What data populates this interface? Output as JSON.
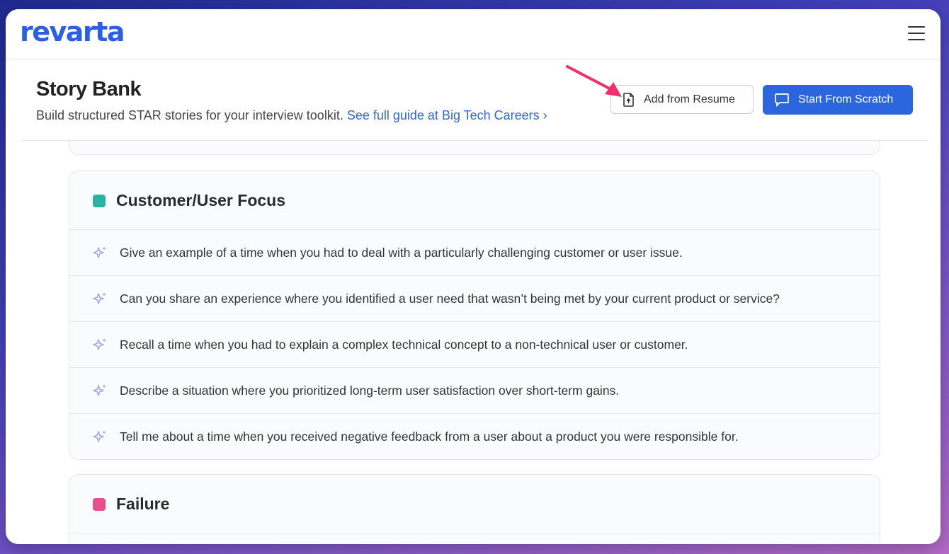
{
  "app": {
    "logo_text": "revarta",
    "brand_color": "#2a5fe6"
  },
  "header": {
    "title": "Story Bank",
    "subtitle": "Build structured STAR stories for your interview toolkit.",
    "guide_link": "See full guide at Big Tech Careers ›",
    "add_from_resume_label": "Add from Resume",
    "start_from_scratch_label": "Start From Scratch"
  },
  "categories": [
    {
      "title": "Customer/User Focus",
      "color": "#2ab3a3",
      "questions": [
        "Give an example of a time when you had to deal with a particularly challenging customer or user issue.",
        "Can you share an experience where you identified a user need that wasn’t being met by your current product or service?",
        "Recall a time when you had to explain a complex technical concept to a non-technical user or customer.",
        "Describe a situation where you prioritized long-term user satisfaction over short-term gains.",
        "Tell me about a time when you received negative feedback from a user about a product you were responsible for."
      ]
    },
    {
      "title": "Failure",
      "color": "#e84f8f",
      "questions": []
    }
  ],
  "icons": {
    "menu": "hamburger-menu-icon",
    "resume": "file-upload-icon",
    "scratch": "chat-bubble-icon",
    "question": "sparkle-icon",
    "annotation": "pointer-arrow"
  }
}
